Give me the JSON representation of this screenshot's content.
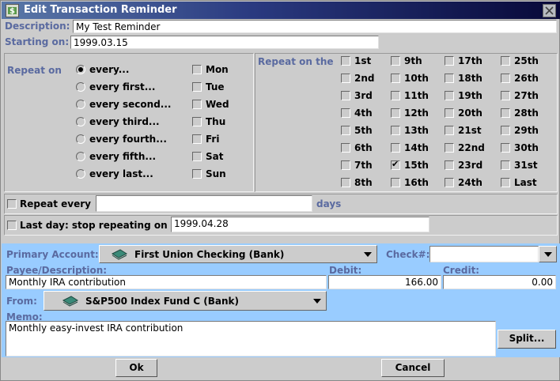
{
  "window": {
    "title": "Edit Transaction Reminder"
  },
  "icons": {
    "app": "dollar-icon",
    "close": "close-icon",
    "account": "bank-account-icon",
    "dropdown": "chevron-down-icon"
  },
  "colors": {
    "label": "#5a6aa0",
    "lower_panel": "#99ccff",
    "title_dark": "#070838"
  },
  "description": {
    "label": "Description:",
    "value": "My Test Reminder"
  },
  "starting": {
    "label": "Starting on:",
    "value": "1999.03.15"
  },
  "repeat_on": {
    "label": "Repeat on",
    "options": [
      "every...",
      "every first...",
      "every second...",
      "every third...",
      "every fourth...",
      "every fifth...",
      "every last..."
    ],
    "selected": 0,
    "weekdays": [
      "Mon",
      "Tue",
      "Wed",
      "Thu",
      "Fri",
      "Sat",
      "Sun"
    ]
  },
  "repeat_on_the": {
    "label": "Repeat on the",
    "days": [
      "1st",
      "2nd",
      "3rd",
      "4th",
      "5th",
      "6th",
      "7th",
      "8th",
      "9th",
      "10th",
      "11th",
      "12th",
      "13th",
      "14th",
      "15th",
      "16th",
      "17th",
      "18th",
      "19th",
      "20th",
      "21st",
      "22nd",
      "23rd",
      "24th",
      "25th",
      "26th",
      "27th",
      "28th",
      "29th",
      "30th",
      "31st",
      "Last"
    ],
    "checked": [
      "15th"
    ]
  },
  "repeat_every": {
    "label": "Repeat every",
    "value": "",
    "unit": "days"
  },
  "last_day": {
    "label": "Last day: stop repeating on",
    "value": "1999.04.28"
  },
  "transaction": {
    "primary_account_label": "Primary Account:",
    "primary_account": "First Union Checking (Bank)",
    "check_label": "Check#:",
    "check_value": "",
    "payee_label": "Payee/Description:",
    "payee": "Monthly IRA contribution",
    "debit_label": "Debit:",
    "debit": "166.00",
    "credit_label": "Credit:",
    "credit": "0.00",
    "from_label": "From:",
    "from_account": "S&P500 Index Fund C (Bank)",
    "memo_label": "Memo:",
    "memo": "Monthly easy-invest IRA contribution",
    "split_label": "Split..."
  },
  "buttons": {
    "ok": "Ok",
    "cancel": "Cancel"
  }
}
